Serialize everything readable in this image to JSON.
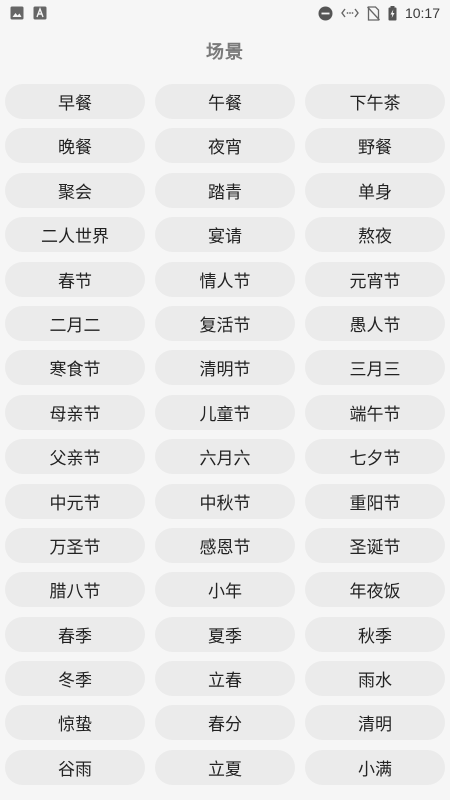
{
  "status_bar": {
    "time": "10:17",
    "left_icons": [
      "image-icon",
      "text-a-icon"
    ],
    "right_icons": [
      "do-not-disturb-icon",
      "data-transfer-icon",
      "no-sim-icon",
      "battery-charging-icon"
    ]
  },
  "page": {
    "title": "场景"
  },
  "scenes": [
    "早餐",
    "午餐",
    "下午茶",
    "晚餐",
    "夜宵",
    "野餐",
    "聚会",
    "踏青",
    "单身",
    "二人世界",
    "宴请",
    "熬夜",
    "春节",
    "情人节",
    "元宵节",
    "二月二",
    "复活节",
    "愚人节",
    "寒食节",
    "清明节",
    "三月三",
    "母亲节",
    "儿童节",
    "端午节",
    "父亲节",
    "六月六",
    "七夕节",
    "中元节",
    "中秋节",
    "重阳节",
    "万圣节",
    "感恩节",
    "圣诞节",
    "腊八节",
    "小年",
    "年夜饭",
    "春季",
    "夏季",
    "秋季",
    "冬季",
    "立春",
    "雨水",
    "惊蛰",
    "春分",
    "清明",
    "谷雨",
    "立夏",
    "小满"
  ]
}
